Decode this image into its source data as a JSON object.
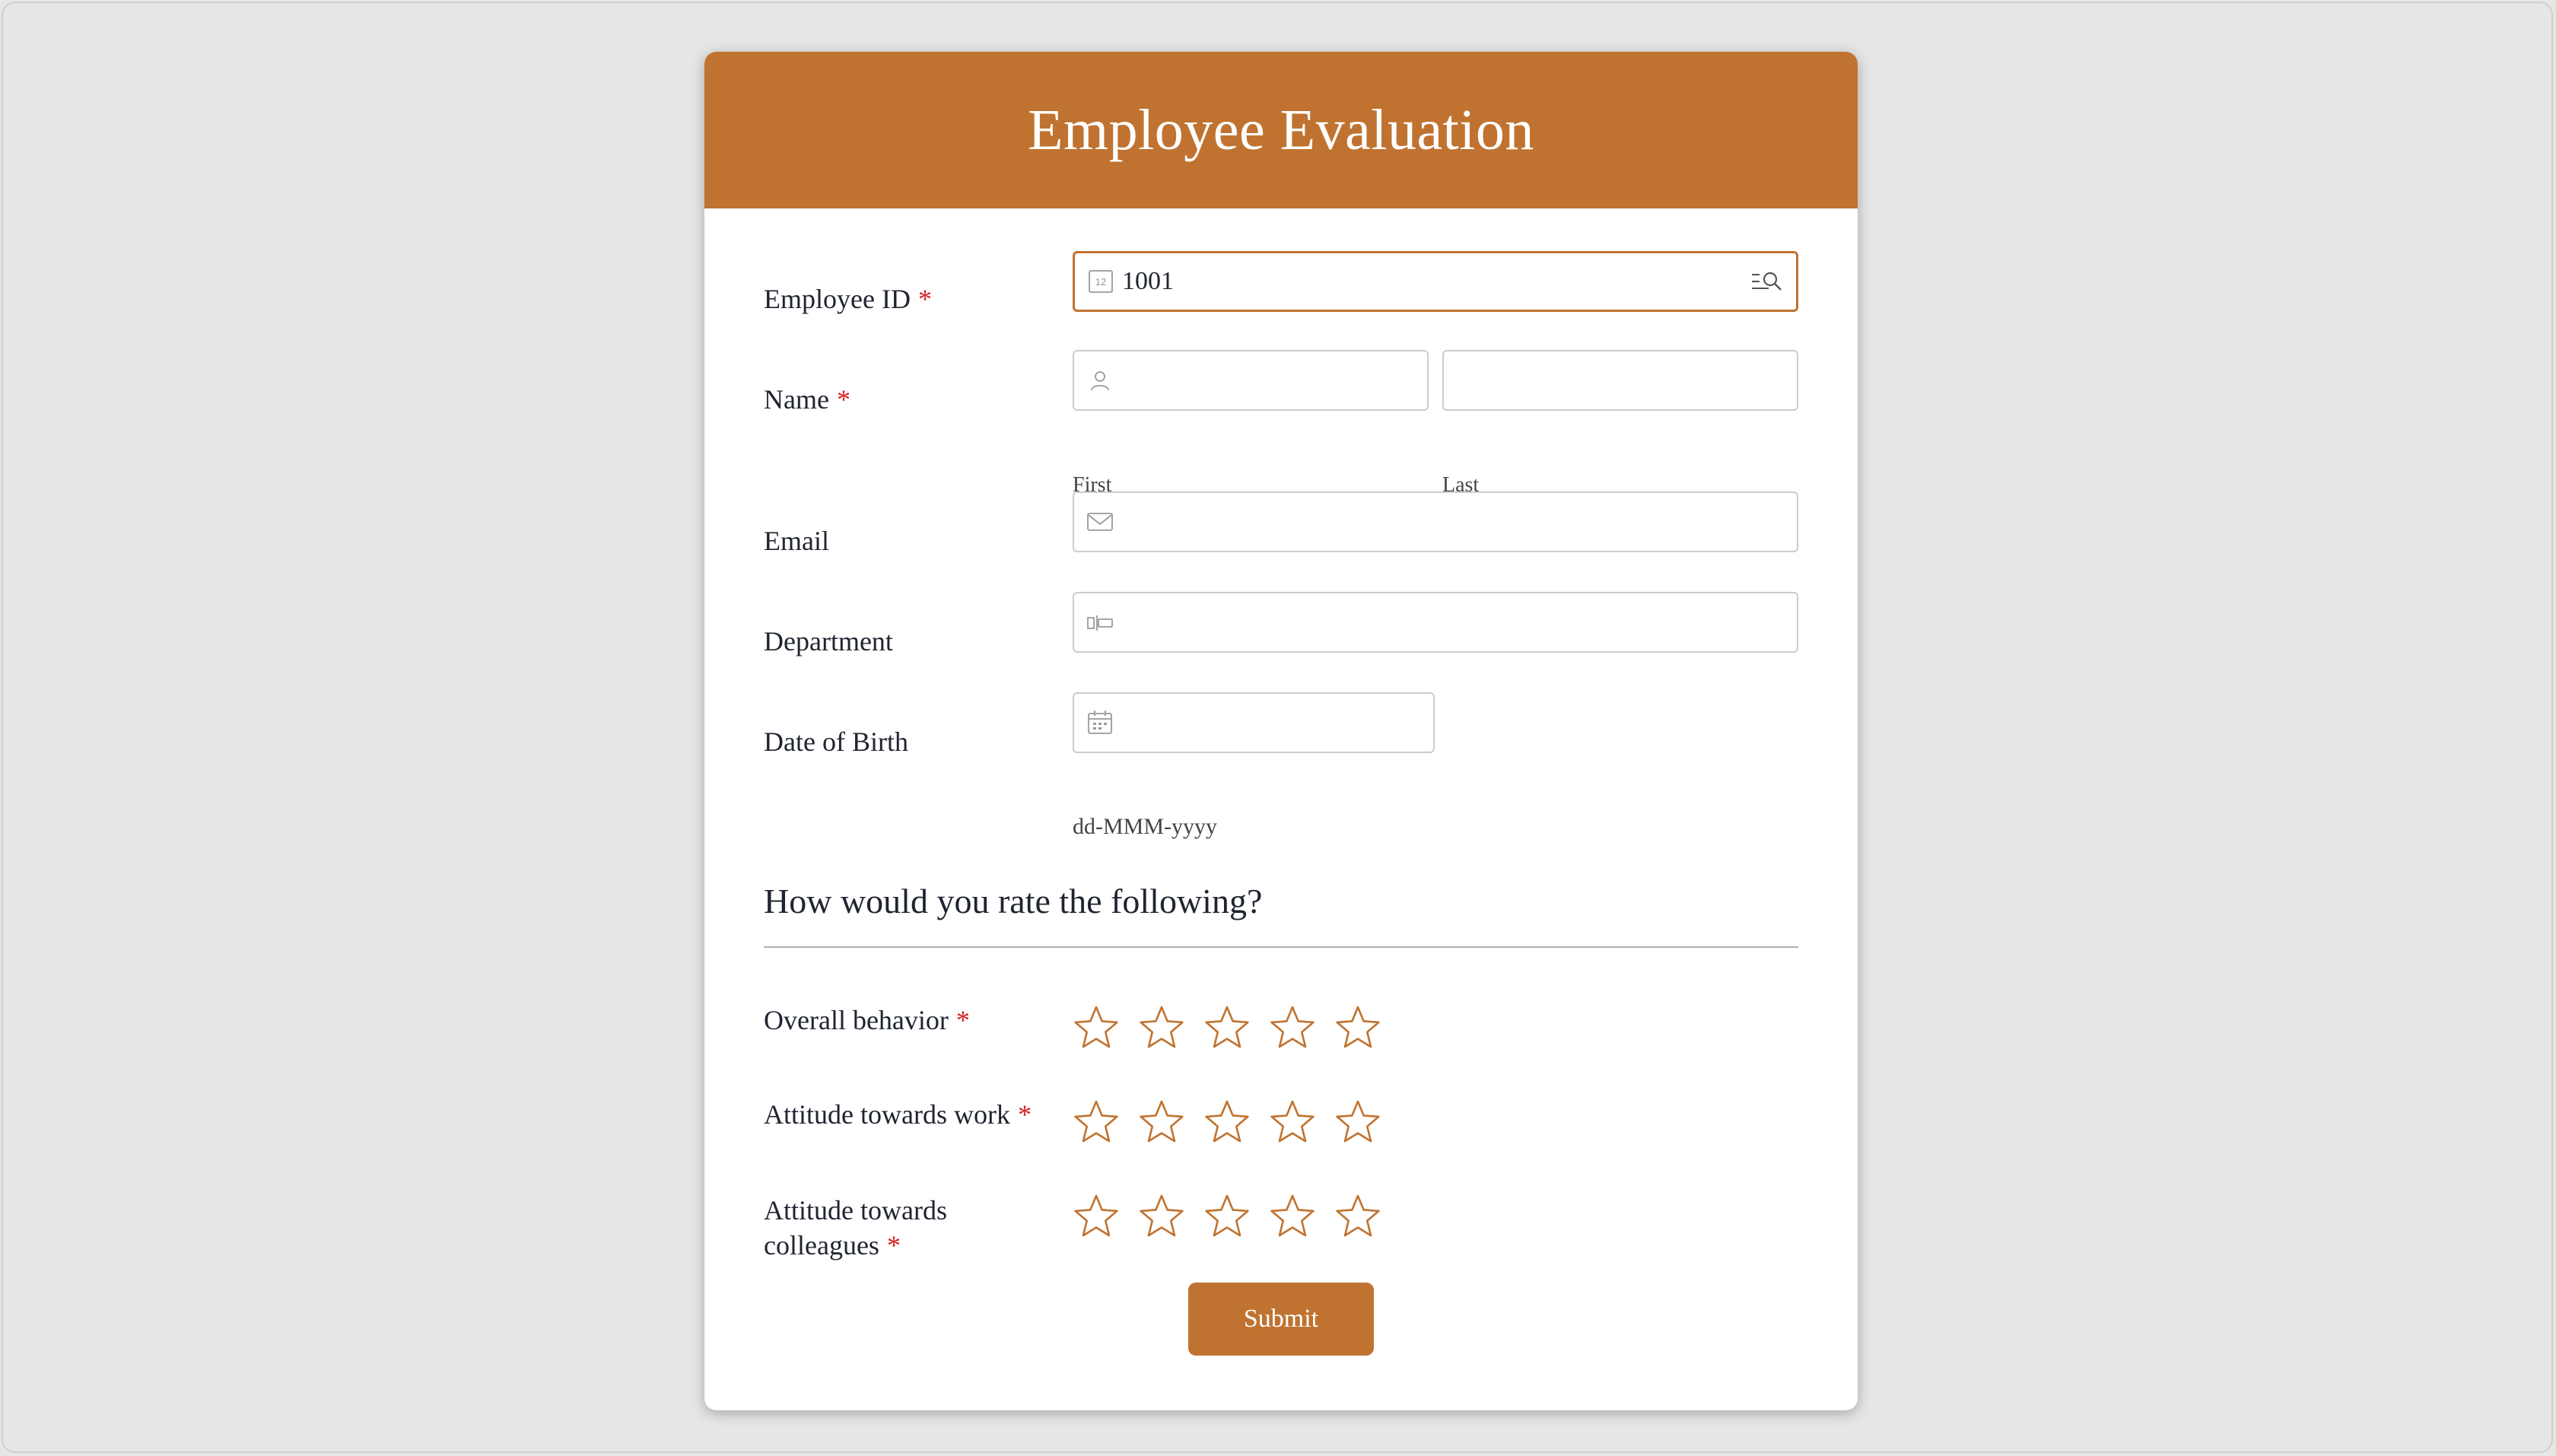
{
  "form": {
    "title": "Employee Evaluation",
    "accent_color": "#c07330",
    "required_marker": "*",
    "fields": {
      "employee_id": {
        "label": "Employee ID",
        "value": "1001",
        "icon": "number-icon",
        "lookup_icon": "lookup-search-icon"
      },
      "name": {
        "label": "Name",
        "first_label": "First",
        "last_label": "Last",
        "first_value": "",
        "last_value": "",
        "icon": "person-icon"
      },
      "email": {
        "label": "Email",
        "value": "",
        "icon": "envelope-icon"
      },
      "department": {
        "label": "Department",
        "value": "",
        "icon": "dropdown-field-icon"
      },
      "dob": {
        "label": "Date of Birth",
        "value": "",
        "format_hint": "dd-MMM-yyyy",
        "icon": "calendar-icon"
      }
    },
    "rating_section": {
      "title": "How would you rate the following?",
      "max_stars": 5,
      "items": [
        {
          "label": "Overall behavior",
          "rating": 0
        },
        {
          "label": "Attitude towards work",
          "rating": 0
        },
        {
          "label_line1": "Attitude towards",
          "label_line2": "colleagues",
          "rating": 0
        }
      ]
    },
    "submit_label": "Submit"
  }
}
